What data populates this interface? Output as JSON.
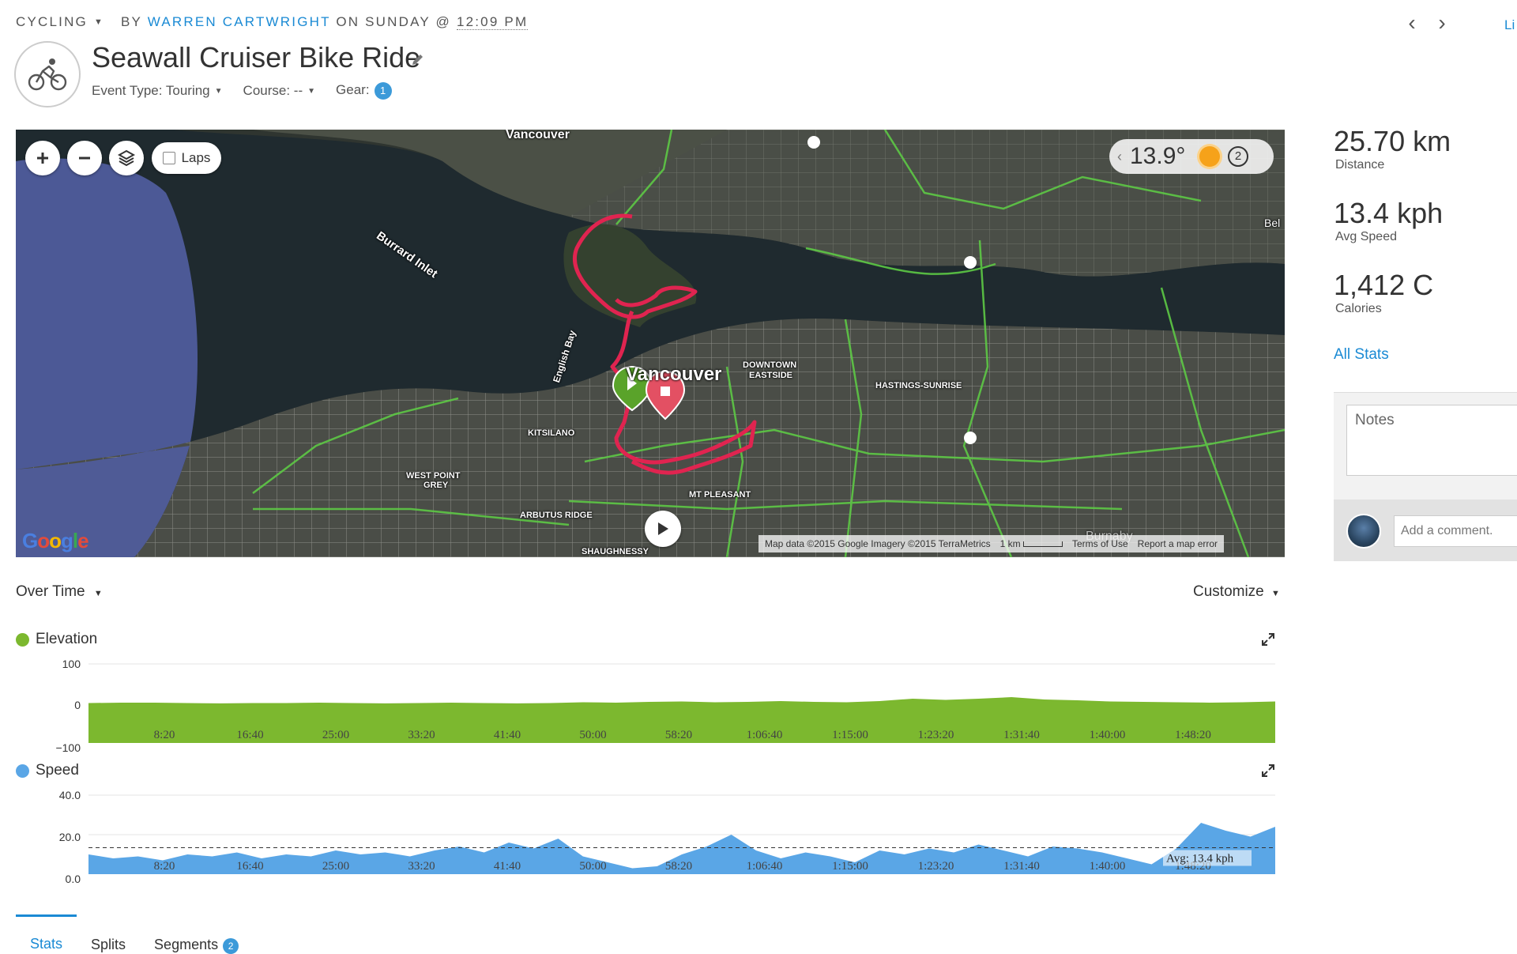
{
  "header": {
    "activity_type": "CYCLING",
    "by": "BY",
    "user": "WARREN CARTWRIGHT",
    "on_day": "ON SUNDAY @",
    "time": "12:09 PM",
    "edge_link": "Li",
    "title": "Seawall Cruiser Bike Ride",
    "event_type": "Event Type: Touring",
    "course": "Course: --",
    "gear_label": "Gear:",
    "gear_count": "1"
  },
  "map": {
    "laps_label": "Laps",
    "temperature": "13.9°",
    "wind": "2",
    "labels": {
      "vancouver_top": "Vancouver",
      "burrard": "Burrard Inlet",
      "english_bay": "English Bay",
      "vancouver": "Vancouver",
      "downtown": "DOWNTOWN",
      "eastside": "EASTSIDE",
      "hastings": "HASTINGS-SUNRISE",
      "kitsilano": "KITSILANO",
      "west_point": "WEST POINT",
      "grey": "GREY",
      "arbutus": "ARBUTUS RIDGE",
      "mt_pleasant": "MT PLEASANT",
      "shaughnessy": "SHAUGHNESSY",
      "bel": "Bel",
      "burnaby": "Burnaby"
    },
    "footer": {
      "data": "Map data ©2015 Google Imagery ©2015 TerraMetrics",
      "scale": "1 km",
      "terms": "Terms of Use",
      "report": "Report a map error"
    },
    "logo": "Google"
  },
  "stats": {
    "distance_value": "25.70 km",
    "distance_label": "Distance",
    "speed_value": "13.4 kph",
    "speed_label": "Avg Speed",
    "calories_value": "1,412 C",
    "calories_label": "Calories",
    "all_stats": "All Stats",
    "notes_placeholder": "Notes",
    "comment_placeholder": "Add a comment."
  },
  "charts_header": {
    "view": "Over Time",
    "customize": "Customize"
  },
  "colors": {
    "elevation": "#7cb82f",
    "speed": "#5aa6e6",
    "route": "#d8304e",
    "accent": "#1a8ad4"
  },
  "chart_data": [
    {
      "type": "area",
      "title": "Elevation",
      "series": [
        {
          "name": "Elevation",
          "values": [
            1,
            2,
            2,
            1,
            0,
            1,
            1,
            2,
            1,
            0,
            1,
            2,
            1,
            0,
            1,
            3,
            2,
            4,
            5,
            3,
            4,
            6,
            4,
            3,
            6,
            12,
            9,
            12,
            16,
            10,
            8,
            5,
            4,
            3,
            2,
            3,
            5
          ]
        }
      ],
      "x_tick_labels": [
        "8:20",
        "16:40",
        "25:00",
        "33:20",
        "41:40",
        "50:00",
        "58:20",
        "1:06:40",
        "1:15:00",
        "1:23:20",
        "1:31:40",
        "1:40:00",
        "1:48:20"
      ],
      "y_tick_labels": [
        "100",
        "0",
        "−100"
      ],
      "ylim": [
        -100,
        100
      ]
    },
    {
      "type": "area",
      "title": "Speed",
      "series": [
        {
          "name": "Speed",
          "values": [
            10,
            8,
            9,
            7,
            10,
            9,
            11,
            8,
            10,
            9,
            12,
            10,
            11,
            9,
            12,
            14,
            11,
            16,
            13,
            18,
            9,
            6,
            3,
            4,
            10,
            14,
            20,
            12,
            8,
            11,
            9,
            6,
            12,
            10,
            13,
            11,
            15,
            12,
            9,
            14,
            13,
            11,
            8,
            5,
            13,
            26,
            22,
            19,
            24
          ]
        }
      ],
      "avg_label": "Avg: 13.4 kph",
      "avg": 13.4,
      "x_tick_labels": [
        "8:20",
        "16:40",
        "25:00",
        "33:20",
        "41:40",
        "50:00",
        "58:20",
        "1:06:40",
        "1:15:00",
        "1:23:20",
        "1:31:40",
        "1:40:00",
        "1:48:20"
      ],
      "y_tick_labels": [
        "40.0",
        "20.0",
        "0.0"
      ],
      "ylim": [
        0,
        40
      ]
    }
  ],
  "tabs": [
    {
      "label": "Stats"
    },
    {
      "label": "Splits"
    },
    {
      "label": "Segments",
      "badge": "2"
    }
  ]
}
